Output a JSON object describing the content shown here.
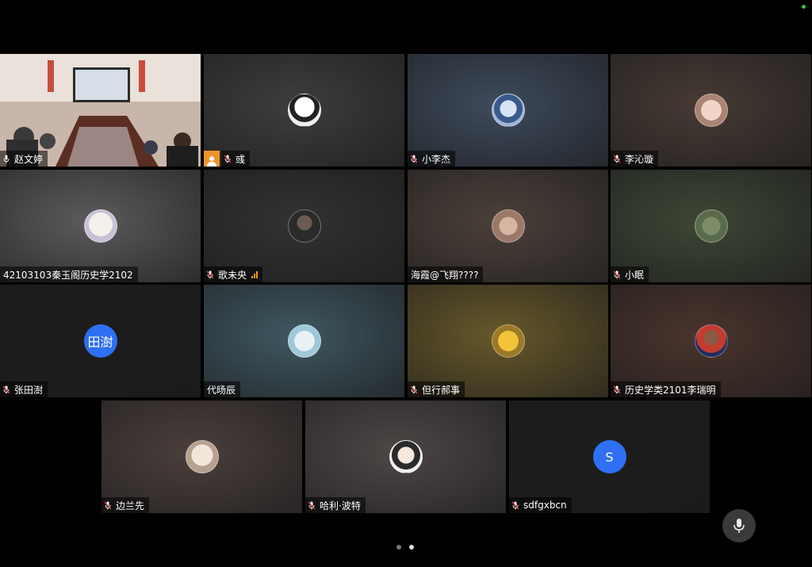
{
  "participants": [
    {
      "name": "赵文婷",
      "bg": "#6d5048",
      "mic": "on",
      "active": true,
      "avatar": "photo-meeting-room"
    },
    {
      "name": "彧",
      "bg": "#3d3d3d",
      "mic": "muted",
      "avatar": "anime-boy",
      "user_icon": "person-icon"
    },
    {
      "name": "小李杰",
      "bg": "#3e4a5c",
      "mic": "muted",
      "avatar": "anime-blue"
    },
    {
      "name": "李沁璇",
      "bg": "#463a34",
      "mic": "muted",
      "avatar": "baby-photo"
    },
    {
      "name": "42103103秦玉阁历史学2102",
      "bg": "#5b5b5c",
      "mic": "none",
      "avatar": "cartoon-white"
    },
    {
      "name": "歌未央",
      "bg": "#333131",
      "mic": "muted",
      "avatar": "man-photo",
      "signal": true
    },
    {
      "name": "海霞@飞翔????",
      "bg": "#4b403a",
      "mic": "none",
      "avatar": "woman-photo"
    },
    {
      "name": "小眠",
      "bg": "#3d4635",
      "mic": "muted",
      "avatar": "green-photo"
    },
    {
      "name": "张田澍",
      "bg": "#1d1d1d",
      "mic": "muted",
      "avatar_text": "田澍"
    },
    {
      "name": "代旸辰",
      "bg": "#3f5761",
      "mic": "none",
      "avatar": "cat-angel"
    },
    {
      "name": "但行郝事",
      "bg": "#66582a",
      "mic": "muted",
      "avatar": "yellow-pokemon"
    },
    {
      "name": "历史学类2101李瑞明",
      "bg": "#4a342d",
      "mic": "muted",
      "avatar": "basketball-player"
    },
    {
      "name": "边兰先",
      "bg": "#4a3f3d",
      "mic": "muted",
      "avatar": "girl-photo"
    },
    {
      "name": "哈利·波特",
      "bg": "#4d4746",
      "mic": "muted",
      "avatar": "anime-dark"
    },
    {
      "name": "sdfgxbcn",
      "bg": "#1d1d1d",
      "mic": "muted",
      "avatar_text": "S"
    }
  ],
  "colors": {
    "accent": "#2f6ff2",
    "active_border": "#5fd35f",
    "muted_mic": "#e5484d"
  },
  "controls": {
    "mic_button": "microphone-icon",
    "pages": 2,
    "current_page": 2
  }
}
